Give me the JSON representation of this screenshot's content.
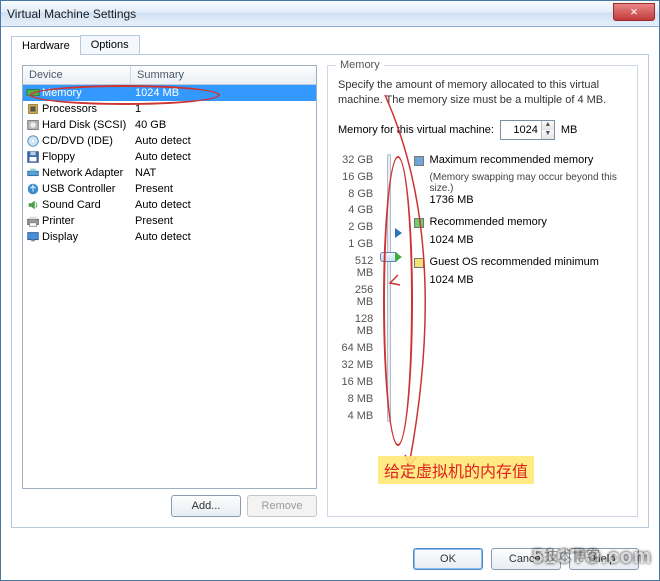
{
  "window": {
    "title": "Virtual Machine Settings",
    "close": "×"
  },
  "tabs": {
    "hardware": "Hardware",
    "options": "Options"
  },
  "devlist": {
    "head": {
      "device": "Device",
      "summary": "Summary"
    },
    "rows": [
      {
        "icon": "memory-icon",
        "name": "Memory",
        "summary": "1024 MB",
        "selected": true
      },
      {
        "icon": "cpu-icon",
        "name": "Processors",
        "summary": "1"
      },
      {
        "icon": "hdd-icon",
        "name": "Hard Disk (SCSI)",
        "summary": "40 GB"
      },
      {
        "icon": "cd-icon",
        "name": "CD/DVD (IDE)",
        "summary": "Auto detect"
      },
      {
        "icon": "floppy-icon",
        "name": "Floppy",
        "summary": "Auto detect"
      },
      {
        "icon": "network-icon",
        "name": "Network Adapter",
        "summary": "NAT"
      },
      {
        "icon": "usb-icon",
        "name": "USB Controller",
        "summary": "Present"
      },
      {
        "icon": "sound-icon",
        "name": "Sound Card",
        "summary": "Auto detect"
      },
      {
        "icon": "printer-icon",
        "name": "Printer",
        "summary": "Present"
      },
      {
        "icon": "display-icon",
        "name": "Display",
        "summary": "Auto detect"
      }
    ]
  },
  "leftbtns": {
    "add": "Add...",
    "remove": "Remove"
  },
  "memory": {
    "group": "Memory",
    "desc": "Specify the amount of memory allocated to this virtual machine. The memory size must be a multiple of 4 MB.",
    "label": "Memory for this virtual machine:",
    "value": "1024",
    "unit": "MB",
    "ticks": [
      "32 GB",
      "16 GB",
      "8 GB",
      "4 GB",
      "2 GB",
      "1 GB",
      "512 MB",
      "256 MB",
      "128 MB",
      "64 MB",
      "32 MB",
      "16 MB",
      "8 MB",
      "4 MB"
    ],
    "legend": {
      "max": {
        "label": "Maximum recommended memory",
        "note": "(Memory swapping may occur beyond this size.)",
        "value": "1736 MB"
      },
      "rec": {
        "label": "Recommended memory",
        "value": "1024 MB"
      },
      "min": {
        "label": "Guest OS recommended minimum",
        "value": "1024 MB"
      }
    }
  },
  "dialogbtns": {
    "ok": "OK",
    "cancel": "Cancel",
    "help": "Help"
  },
  "annotation": "给定虚拟机的内存值",
  "watermark": {
    "domain": "51CTO.com",
    "text": "技术博客"
  }
}
